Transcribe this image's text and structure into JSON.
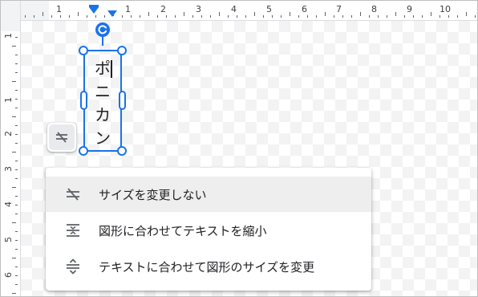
{
  "ruler": {
    "top_numbers": [
      "1",
      "1",
      "2",
      "3",
      "4",
      "5",
      "6",
      "7",
      "8",
      "9",
      "10"
    ],
    "left_numbers": [
      "1",
      "1",
      "2",
      "3",
      "4",
      "5",
      "6"
    ]
  },
  "textbox": {
    "chars": [
      "ポ",
      "ニ",
      "カ",
      "ン"
    ]
  },
  "menu": {
    "items": [
      {
        "label": "サイズを変更しない",
        "icon": "no-autofit-icon",
        "selected": true
      },
      {
        "label": "図形に合わせてテキストを縮小",
        "icon": "shrink-text-icon",
        "selected": false
      },
      {
        "label": "テキストに合わせて図形のサイズを変更",
        "icon": "resize-shape-icon",
        "selected": false
      }
    ]
  },
  "colors": {
    "accent": "#1a73e8",
    "menu_hover": "#eeeeee",
    "text": "#202124",
    "icon": "#5f6368"
  }
}
